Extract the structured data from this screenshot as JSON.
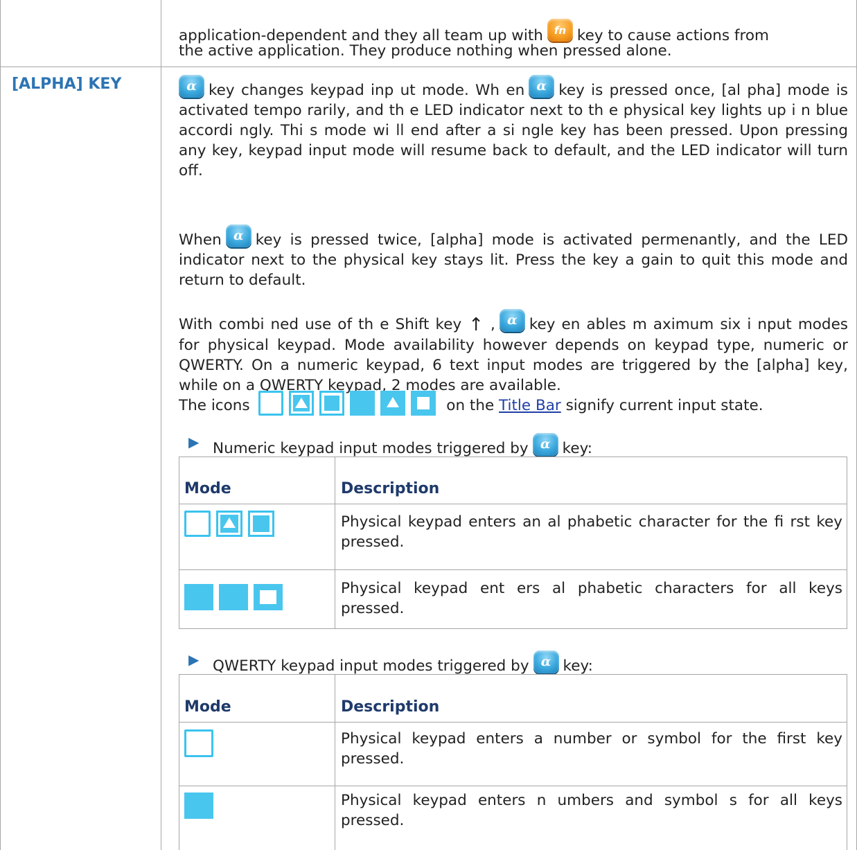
{
  "intro": {
    "line1_a": "application-dependent and they all team up with",
    "line1_b": "key to cause actions from",
    "line2": "the active application. They produce nothing when pressed alone."
  },
  "section": {
    "label": "[ALPHA] KEY",
    "p1_a": "key changes keypad inp ut mode. Wh en",
    "p1_b": "key is pressed once, [al pha] mode is activated tempo rarily, and th e LED indicator next to th e physical key lights up i n blue accordi ngly. Thi s mode wi ll end after a si ngle key has been pressed. Upon pressing any key, keypad input mode will resume back to default, and the LED indicator will turn off.",
    "p2_a": "When",
    "p2_b": "key is pressed twice, [alpha] mode is activated permenantly, and the LED indicator next to the physical key stays lit. Press the key a gain to quit this mode and return to default.",
    "p3_a": "With combi ned use of th e Shift key",
    "p3_b": "key en ables m aximum six i nput modes for physical keypad. Mode availability however depends on keypad type, numeric or QWERTY. On a numeric keypad, 6 text input modes are triggered by the [alpha] key, while on a QWERTY keypad, 2 modes are available.",
    "p4_a": "The icons",
    "p4_b": "on the",
    "p4_link": "Title Bar",
    "p4_c": "signify current input state.",
    "bullet1": "Numeric keypad input modes triggered by",
    "bullet1_end": "key:",
    "bullet2": "QWERTY keypad input modes triggered by",
    "bullet2_end": "key:"
  },
  "numeric_table": {
    "headers": [
      "Mode",
      "Description"
    ],
    "rows": [
      {
        "icons": [
          "outline-square-icon",
          "triangle-square-icon",
          "inner-square-icon"
        ],
        "description": "Physical keypad enters an al phabetic character for the fi rst key pressed."
      },
      {
        "icons": [
          "filled-square-icon",
          "filled-square-icon",
          "filled-hollow-square-icon"
        ],
        "description": "Physical  keypad ent ers al phabetic characters  for all keys pressed."
      }
    ]
  },
  "qwerty_table": {
    "headers": [
      "Mode",
      "Description"
    ],
    "rows": [
      {
        "icons": [
          "outline-square-icon"
        ],
        "description": "Physical keypad enters a number or symbol for the first key pressed."
      },
      {
        "icons": [
          "filled-square-icon"
        ],
        "description": "Physical keypad enters n umbers and symbol s for all keys pressed."
      }
    ]
  },
  "colors": {
    "accent": "#2c74b3",
    "icon": "#49c6ee",
    "link": "#1f3fa6",
    "heading": "#1f3a6b"
  }
}
